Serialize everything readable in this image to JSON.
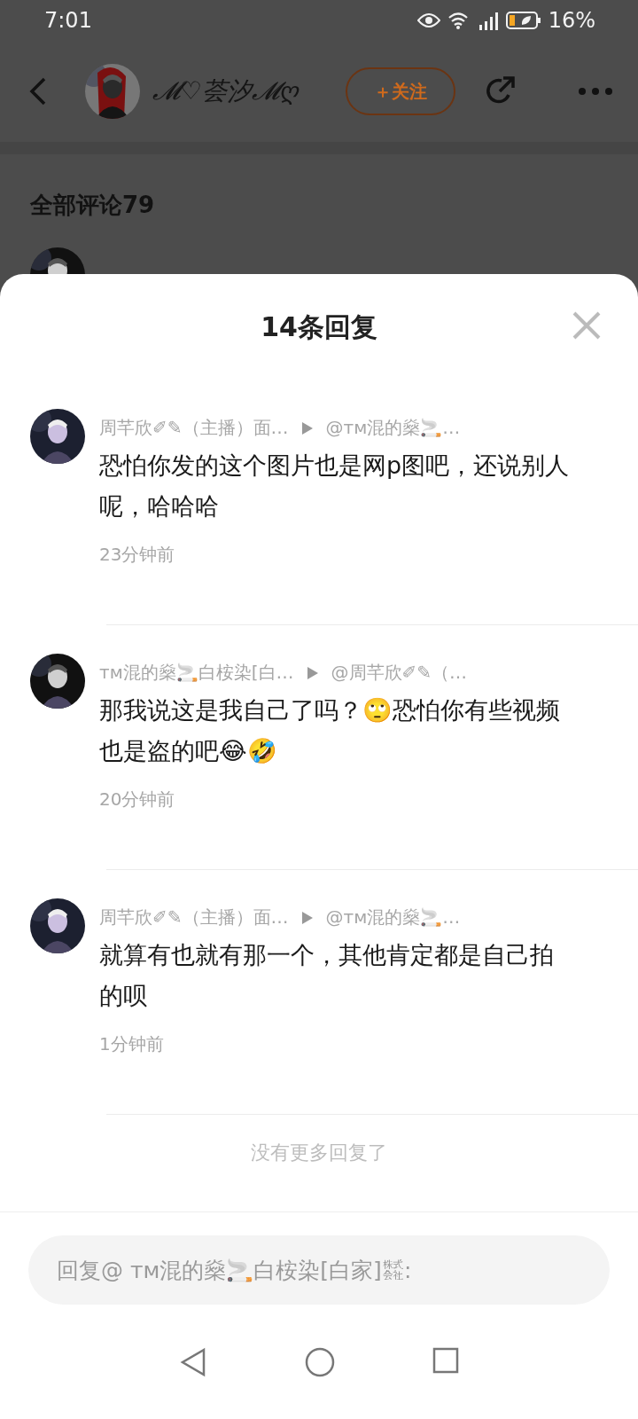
{
  "status_bar": {
    "time": "7:01",
    "battery": "16%"
  },
  "header": {
    "name": "𝓜♡荟汐𝓜ღ",
    "follow_button": "＋关注"
  },
  "comments_section": {
    "title": "全部评论79"
  },
  "reply_sheet": {
    "title": "14条回复",
    "replies": [
      {
        "name": "周芊欣✐✎（主播）面…",
        "target": "@ᴛᴍ混的燊🚬…",
        "body": "恐怕你发的这个图片也是网p图吧，还说别人呢，哈哈哈",
        "time": "23分钟前"
      },
      {
        "name": "ᴛᴍ混的燊🚬白桉染[白…",
        "target": "@周芊欣✐✎（…",
        "body": "那我说这是我自己了吗？🙄恐怕你有些视频也是盗的吧😂🤣",
        "time": "20分钟前"
      },
      {
        "name": "周芊欣✐✎（主播）面…",
        "target": "@ᴛᴍ混的燊🚬…",
        "body": "就算有也就有那一个，其他肯定都是自己拍的呗",
        "time": "1分钟前"
      }
    ],
    "end_note": "没有更多回复了",
    "reply_input": {
      "placeholder": "回复@ ᴛᴍ混的燊🚬白桉染[白家]㍿:"
    }
  }
}
